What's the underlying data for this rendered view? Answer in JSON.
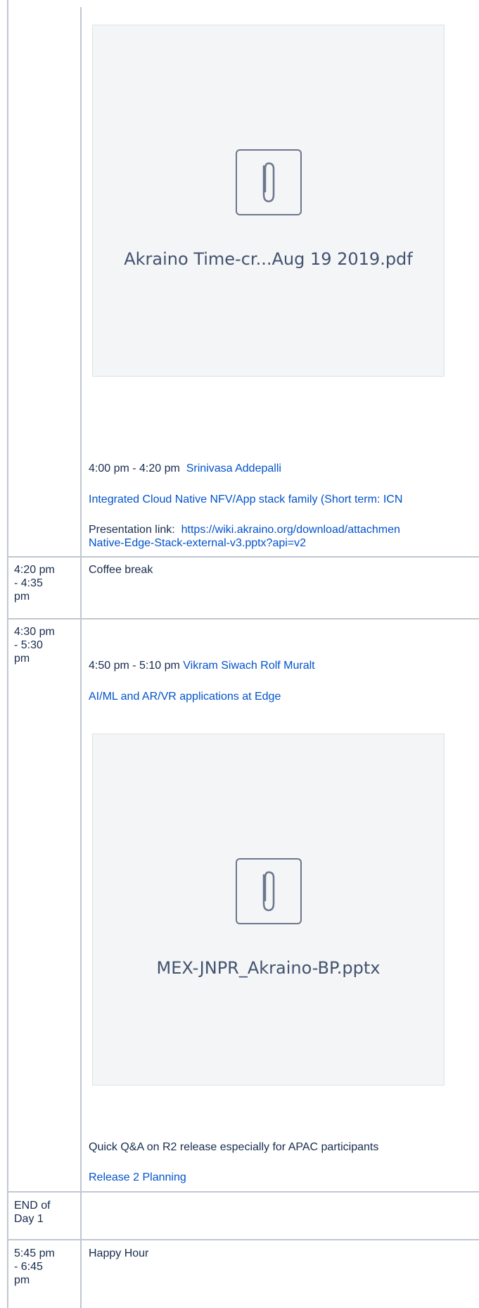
{
  "slot1": {
    "attachment_name": "Akraino Time-cr...Aug 19 2019.pdf",
    "talk_time": "4:00 pm - 4:20 pm",
    "speaker": "Srinivasa Addepalli",
    "talk_title": "Integrated Cloud Native NFV/App stack family (Short term: ICN",
    "presentation_label": "Presentation link:",
    "presentation_url_line1": "https://wiki.akraino.org/download/attachmen",
    "presentation_url_line2": "Native-Edge-Stack-external-v3.pptx?api=v2"
  },
  "coffee": {
    "time_line1": "4:20 pm",
    "time_line2": "- 4:35",
    "time_line3": "pm",
    "label": "Coffee break"
  },
  "slot2": {
    "time_line1": "4:30 pm",
    "time_line2": "- 5:30",
    "time_line3": "pm",
    "talk_time": "4:50 pm - 5:10 pm",
    "speaker1": "Vikram Siwach",
    "speaker2": "Rolf Muralt",
    "talk_title": "AI/ML and AR/VR applications at Edge",
    "attachment_name": "MEX-JNPR_Akraino-BP.pptx",
    "qa_text": "Quick Q&A on R2 release especially for APAC participants",
    "qa_link": "Release 2 Planning"
  },
  "end_day": {
    "line1": "END of",
    "line2": "Day 1"
  },
  "happy_hour": {
    "time_line1": "5:45 pm",
    "time_line2": "- 6:45",
    "time_line3": "pm",
    "label": "Happy Hour"
  },
  "colors": {
    "text": "#172b4d",
    "link": "#0052cc",
    "border": "#c1c7d0",
    "attachment_bg": "#f4f5f7"
  },
  "icons": [
    "paperclip-icon"
  ]
}
